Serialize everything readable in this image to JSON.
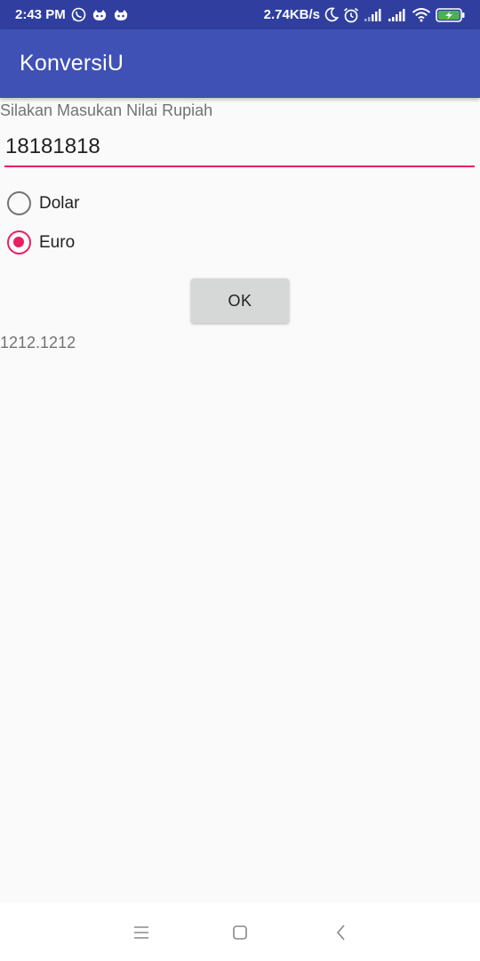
{
  "status_bar": {
    "time": "2:43 PM",
    "left_icons": [
      "whatsapp-icon",
      "robot-icon",
      "robot-icon"
    ],
    "network_speed": "2.74KB/s",
    "right_icons": [
      "moon-icon",
      "alarm-icon",
      "signal-icon",
      "signal-icon",
      "wifi-icon",
      "battery-charging-icon"
    ]
  },
  "app_bar": {
    "title": "KonversiU"
  },
  "form": {
    "prompt": "Silakan Masukan Nilai Rupiah",
    "amount_value": "18181818",
    "options": [
      {
        "label": "Dolar",
        "checked": false
      },
      {
        "label": "Euro",
        "checked": true
      }
    ],
    "ok_label": "OK",
    "result": "1212.1212"
  },
  "colors": {
    "status_bar": "#303f9f",
    "app_bar": "#3f51b5",
    "accent": "#e91e63",
    "background": "#fafafa",
    "button": "#d6d7d7"
  },
  "nav_bar": {
    "icons": [
      "menu-icon",
      "home-square-icon",
      "back-icon"
    ]
  }
}
